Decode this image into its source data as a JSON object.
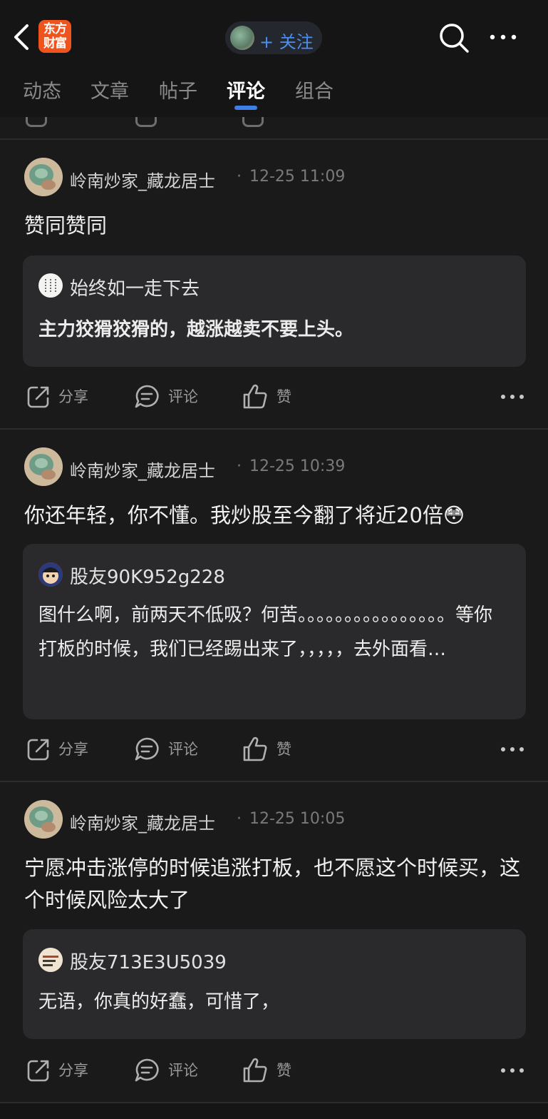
{
  "header": {
    "logo_text_line1": "东方",
    "logo_text_line2": "财富",
    "follow_label": "+ 关注"
  },
  "tabs": [
    {
      "label": "动态"
    },
    {
      "label": "文章"
    },
    {
      "label": "帖子"
    },
    {
      "label": "评论"
    },
    {
      "label": "组合"
    }
  ],
  "active_tab": "评论",
  "posts": [
    {
      "author": "岭南炒家_藏龙居士",
      "time": "12-25 11:09",
      "body": "赞同赞同",
      "quote": {
        "user": "始终如一走下去",
        "text": "主力狡猾狡猾的，越涨越卖不要上头。"
      },
      "actions": {
        "share": "分享",
        "comment": "评论",
        "like": "赞"
      }
    },
    {
      "author": "岭南炒家_藏龙居士",
      "time": "12-25 10:39",
      "body": "你还年轻，你不懂。我炒股至今翻了将近20倍",
      "emoji": "😳",
      "quote": {
        "user": "股友90K952g228",
        "text": "图什么啊，前两天不低吸？何苦。。。。。。。。。。。。。。。。等你打板的时候，我们已经踢出来了，，，，，去外面看…"
      },
      "actions": {
        "share": "分享",
        "comment": "评论",
        "like": "赞"
      }
    },
    {
      "author": "岭南炒家_藏龙居士",
      "time": "12-25 10:05",
      "body": "宁愿冲击涨停的时候追涨打板，也不愿这个时候买，这个时候风险太大了",
      "quote": {
        "user": "股友713E3U5039",
        "text": "无语，你真的好蠢，可惜了，"
      },
      "actions": {
        "share": "分享",
        "comment": "评论",
        "like": "赞"
      }
    }
  ],
  "colors": {
    "accent": "#3d7fe6",
    "logo": "#f0541e",
    "background": "#1a1a1a"
  }
}
